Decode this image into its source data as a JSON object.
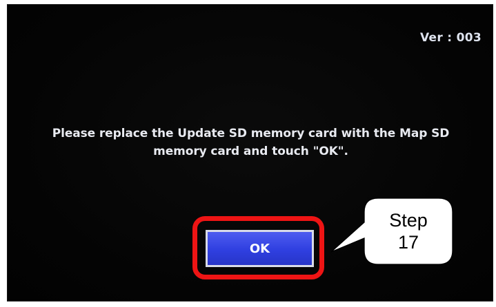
{
  "screen": {
    "version": "Ver : 003",
    "message": "Please replace the Update SD memory card with the Map SD memory card and touch \"OK\".",
    "ok_label": "OK"
  },
  "callout": {
    "line1": "Step",
    "line2": "17"
  },
  "colors": {
    "highlight": "#ee1414",
    "button": "#3341e5",
    "screen_bg": "#050505"
  }
}
